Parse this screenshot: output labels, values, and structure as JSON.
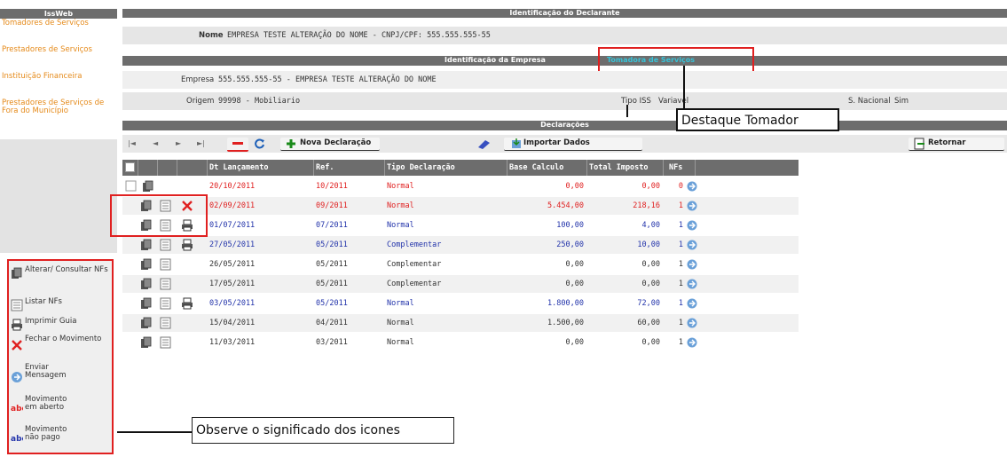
{
  "sidebar": {
    "title": "IssWeb",
    "links": [
      "Tomadores de Serviços",
      "Prestadores de Serviços",
      "Instituição Financeira",
      "Prestadores de Serviços de Fora do Município"
    ],
    "legend": [
      {
        "icon": "documents-icon",
        "label": "Alterar/ Consultar NFs"
      },
      {
        "icon": "list-icon",
        "label": "Listar NFs"
      },
      {
        "icon": "printer-icon",
        "label": "Imprimir Guia"
      },
      {
        "icon": "close-x-icon",
        "label": "Fechar o Movimento"
      },
      {
        "icon": "send-message-icon",
        "label": "Enviar Mensagem"
      },
      {
        "icon": "abc-red-icon",
        "label": "Movimento em aberto"
      },
      {
        "icon": "abc-blue-icon",
        "label": "Movimento não pago"
      }
    ]
  },
  "declarante": {
    "header": "Identificação do Declarante",
    "nome_label": "Nome",
    "nome_value": "EMPRESA TESTE ALTERAÇÃO DO NOME - CNPJ/CPF: 555.555.555-55"
  },
  "empresa": {
    "header_left": "Identificação da Empresa",
    "header_link": "Tomadora de Serviços",
    "empresa_label": "Empresa",
    "empresa_value": "555.555.555-55 - EMPRESA TESTE ALTERAÇÃO DO NOME",
    "origem_label": "Origem",
    "origem_value": "99998 - Mobiliario",
    "tipo_label": "Tipo ISS",
    "tipo_value": "Variavel",
    "sn_label": "S. Nacional",
    "sn_value": "Sim"
  },
  "declaracoes": {
    "header": "Declarações",
    "toolbar": {
      "first": "|◄",
      "prev": "◄",
      "next": "►",
      "last": "►|",
      "nova": "Nova Declaração",
      "importar": "Importar Dados",
      "retornar": "Retornar"
    },
    "columns": [
      "Dt Lançamento",
      "Ref.",
      "Tipo Declaração",
      "Base Calculo",
      "Total Imposto",
      "NFs"
    ],
    "rows": [
      {
        "date": "20/10/2011",
        "ref": "10/2011",
        "tipo": "Normal",
        "base": "0,00",
        "total": "0,00",
        "nfs": "0",
        "color": "red",
        "icons": [
          "checkbox",
          "doc"
        ]
      },
      {
        "date": "02/09/2011",
        "ref": "09/2011",
        "tipo": "Normal",
        "base": "5.454,00",
        "total": "218,16",
        "nfs": "1",
        "color": "red",
        "icons": [
          "doc",
          "list",
          "x"
        ]
      },
      {
        "date": "01/07/2011",
        "ref": "07/2011",
        "tipo": "Normal",
        "base": "100,00",
        "total": "4,00",
        "nfs": "1",
        "color": "blue",
        "icons": [
          "doc",
          "list",
          "print"
        ]
      },
      {
        "date": "27/05/2011",
        "ref": "05/2011",
        "tipo": "Complementar",
        "base": "250,00",
        "total": "10,00",
        "nfs": "1",
        "color": "blue",
        "icons": [
          "doc",
          "list",
          "print"
        ]
      },
      {
        "date": "26/05/2011",
        "ref": "05/2011",
        "tipo": "Complementar",
        "base": "0,00",
        "total": "0,00",
        "nfs": "1",
        "color": "black",
        "icons": [
          "doc",
          "list"
        ]
      },
      {
        "date": "17/05/2011",
        "ref": "05/2011",
        "tipo": "Complementar",
        "base": "0,00",
        "total": "0,00",
        "nfs": "1",
        "color": "black",
        "icons": [
          "doc",
          "list"
        ]
      },
      {
        "date": "03/05/2011",
        "ref": "05/2011",
        "tipo": "Normal",
        "base": "1.800,00",
        "total": "72,00",
        "nfs": "1",
        "color": "blue",
        "icons": [
          "doc",
          "list",
          "print"
        ]
      },
      {
        "date": "15/04/2011",
        "ref": "04/2011",
        "tipo": "Normal",
        "base": "1.500,00",
        "total": "60,00",
        "nfs": "1",
        "color": "black",
        "icons": [
          "doc",
          "list"
        ]
      },
      {
        "date": "11/03/2011",
        "ref": "03/2011",
        "tipo": "Normal",
        "base": "0,00",
        "total": "0,00",
        "nfs": "1",
        "color": "black",
        "icons": [
          "doc",
          "list"
        ]
      }
    ]
  },
  "annotations": {
    "destaque": "Destaque Tomador",
    "observe": "Observe o significado dos icones"
  },
  "colors": {
    "red": "#e02020",
    "blue": "#2233aa",
    "black": "#333333",
    "orange_link": "#e58a1a",
    "header_gray": "#6d6d6d"
  }
}
